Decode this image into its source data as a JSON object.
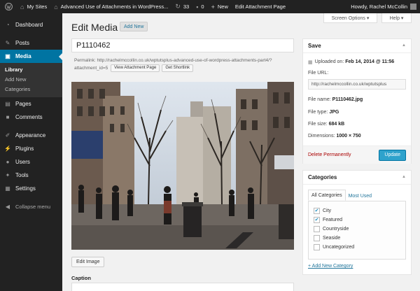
{
  "adminbar": {
    "my_sites": "My Sites",
    "site_name": "Advanced Use of Attachments in WordPress...",
    "updates_count": "33",
    "comments_count": "0",
    "new_label": "New",
    "edit_attachment_page": "Edit Attachment Page",
    "howdy": "Howdy, Rachel McCollin"
  },
  "sidebar": {
    "items": [
      {
        "label": "Dashboard",
        "icon": "dashboard-icon",
        "glyph": "◔"
      },
      {
        "label": "Posts",
        "icon": "pushpin-icon",
        "glyph": "✎"
      },
      {
        "label": "Media",
        "icon": "media-icon",
        "glyph": "▣"
      },
      {
        "label": "Pages",
        "icon": "page-icon",
        "glyph": "▤"
      },
      {
        "label": "Comments",
        "icon": "comment-icon",
        "glyph": "■"
      },
      {
        "label": "Appearance",
        "icon": "brush-icon",
        "glyph": "✐"
      },
      {
        "label": "Plugins",
        "icon": "plugin-icon",
        "glyph": "⚡"
      },
      {
        "label": "Users",
        "icon": "users-icon",
        "glyph": "●"
      },
      {
        "label": "Tools",
        "icon": "wrench-icon",
        "glyph": "✦"
      },
      {
        "label": "Settings",
        "icon": "settings-icon",
        "glyph": "▦"
      }
    ],
    "media_submenu": [
      "Library",
      "Add New",
      "Categories"
    ],
    "collapse": "Collapse menu"
  },
  "tabs": {
    "screen_options": "Screen Options ▾",
    "help": "Help ▾"
  },
  "main": {
    "heading": "Edit Media",
    "add_new": "Add New",
    "title_value": "P1110462",
    "permalink_label": "Permalink:",
    "permalink_url": "http://rachelmccollin.co.uk/wptutsplus-advanced-use-of-wordpress-attachments-part4/?attachment_id=5",
    "view_attachment_page": "View Attachment Page",
    "get_shortlink": "Get Shortlink",
    "edit_image": "Edit Image",
    "caption_label": "Caption"
  },
  "save_box": {
    "title": "Save",
    "uploaded_label": "Uploaded on:",
    "uploaded_value": "Feb 14, 2014 @ 11:56",
    "file_url_label": "File URL:",
    "file_url_value": "http://rachelmccollin.co.uk/wptutsplus",
    "file_name_label": "File name:",
    "file_name_value": "P1110462.jpg",
    "file_type_label": "File type:",
    "file_type_value": "JPG",
    "file_size_label": "File size:",
    "file_size_value": "684 kB",
    "dimensions_label": "Dimensions:",
    "dimensions_value": "1000 × 750",
    "delete": "Delete Permanently",
    "update": "Update"
  },
  "categories_box": {
    "title": "Categories",
    "tab_all": "All Categories",
    "tab_used": "Most Used",
    "items": [
      {
        "label": "City",
        "checked": true
      },
      {
        "label": "Featured",
        "checked": true
      },
      {
        "label": "Countryside",
        "checked": false
      },
      {
        "label": "Seaside",
        "checked": false
      },
      {
        "label": "Uncategorized",
        "checked": false
      }
    ],
    "add_new": "+ Add New Category"
  },
  "colors": {
    "admin_bar": "#222222",
    "active_menu": "#0074a2",
    "update_button": "#2ea2cc",
    "delete_link": "#aa0000",
    "link": "#21759b"
  }
}
